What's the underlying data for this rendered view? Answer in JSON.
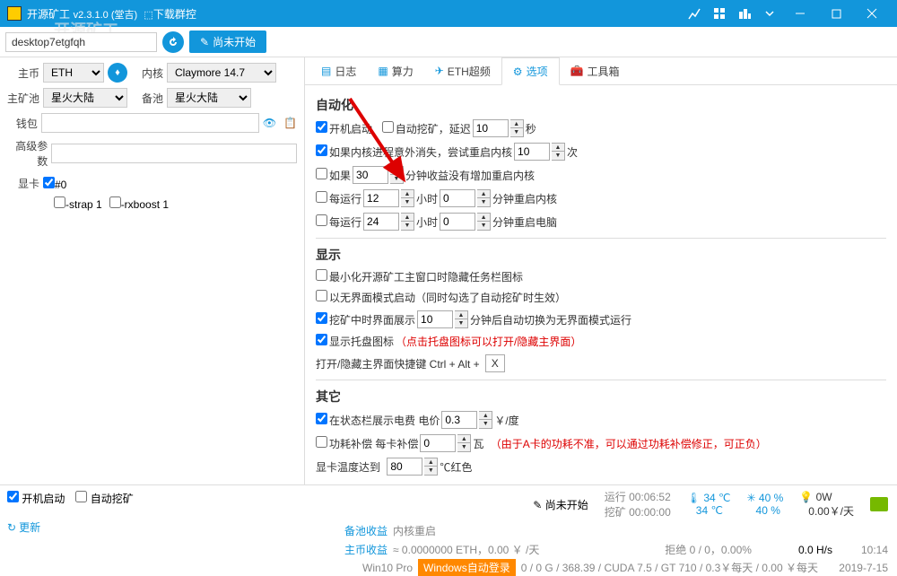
{
  "titlebar": {
    "app_name": "开源矿工",
    "version": "v2.3.1.0 (堂吉)",
    "download_link": "下载群控"
  },
  "toolbar": {
    "hostname": "desktop7etgfqh",
    "start_button": "尚未开始"
  },
  "left": {
    "coin_label": "主币",
    "coin_value": "ETH",
    "kernel_label": "内核",
    "kernel_value": "Claymore 14.7",
    "mainpool_label": "主矿池",
    "mainpool_value": "星火大陆",
    "backpool_label": "备池",
    "backpool_value": "星火大陆",
    "wallet_label": "钱包",
    "advparam_label": "高级参数",
    "gpu_label": "显卡",
    "gpu0": "#0",
    "strap": "-strap 1",
    "rxboost": "-rxboost 1"
  },
  "tabs": {
    "log": "日志",
    "hash": "算力",
    "oc": "ETH超频",
    "options": "选项",
    "toolbox": "工具箱"
  },
  "auto": {
    "title": "自动化",
    "boot_start": "开机启动",
    "auto_mine": "自动挖矿，延迟",
    "auto_mine_val": "10",
    "auto_mine_unit": "秒",
    "kernel_crash": "如果内核进程意外消失，尝试重启内核",
    "kernel_crash_val": "10",
    "kernel_crash_unit": "次",
    "if_label": "如果",
    "if_val": "30",
    "if_suffix": "分钟收益没有增加重启内核",
    "every_run1": "每运行",
    "every_run1_val": "12",
    "hour_label": "小时",
    "every_run1_min": "0",
    "every_run1_suffix": "分钟重启内核",
    "every_run2": "每运行",
    "every_run2_val": "24",
    "every_run2_min": "0",
    "every_run2_suffix": "分钟重启电脑"
  },
  "display": {
    "title": "显示",
    "min_hide": "最小化开源矿工主窗口时隐藏任务栏图标",
    "no_ui": "以无界面模式启动（同时勾选了自动挖矿时生效）",
    "mining_ui": "挖矿中时界面展示",
    "mining_ui_val": "10",
    "mining_ui_suffix": "分钟后自动切换为无界面模式运行",
    "tray": "显示托盘图标",
    "tray_note": "（点击托盘图标可以打开/隐藏主界面）",
    "hotkey_label": "打开/隐藏主界面快捷键 Ctrl + Alt +",
    "hotkey_val": "X"
  },
  "other": {
    "title": "其它",
    "elec": "在状态栏展示电费   电价",
    "elec_val": "0.3",
    "elec_unit": "￥/度",
    "power": "功耗补偿   每卡补偿",
    "power_val": "0",
    "power_unit": "瓦",
    "power_note": "（由于A卡的功耗不准，可以通过功耗补偿修正，可正负）",
    "gpu_temp": "显卡温度达到",
    "gpu_temp_val": "80",
    "gpu_temp_unit": "℃红色"
  },
  "footer": {
    "boot_start": "开机启动",
    "auto_mine": "自动挖矿",
    "update": "更新",
    "status": "尚未开始",
    "run_label": "运行",
    "run_time": "00:06:52",
    "mine_label": "挖矿",
    "mine_time": "00:00:00",
    "temp1": "34 ℃",
    "temp2": "34 ℃",
    "fan1": "40 %",
    "fan2": "40 %",
    "power1": "0W",
    "power2": "0.00￥/天",
    "backup_label": "备池收益",
    "kernel_restart": "内核重启",
    "main_coin_label": "主币收益",
    "main_coin_val": "≈ 0.0000000 ETH，0.00 ￥ /天",
    "reject": "拒绝 0 / 0，0.00%",
    "hashrate": "0.0 H/s",
    "time": "10:14",
    "os": "Win10 Pro",
    "auto_login": "Windows自动登录",
    "gpu_info": "0 / 0 G / 368.39 / CUDA 7.5 / GT 710 / 0.3￥每天 / 0.00 ￥每天",
    "date": "2019-7-15"
  }
}
